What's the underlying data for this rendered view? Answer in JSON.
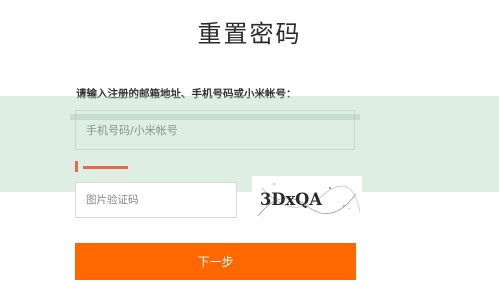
{
  "header": {
    "title": "重置密码"
  },
  "form": {
    "instruction": "请输入注册的邮箱地址、手机号码或小米帐号：",
    "account_placeholder": "手机号码/小米帐号",
    "captcha_placeholder": "图片验证码",
    "captcha_text": "3DxQA",
    "next_label": "下一步"
  },
  "colors": {
    "accent": "#ff6700",
    "error": "#e46a4a",
    "overlay": "#b0d6bc"
  }
}
